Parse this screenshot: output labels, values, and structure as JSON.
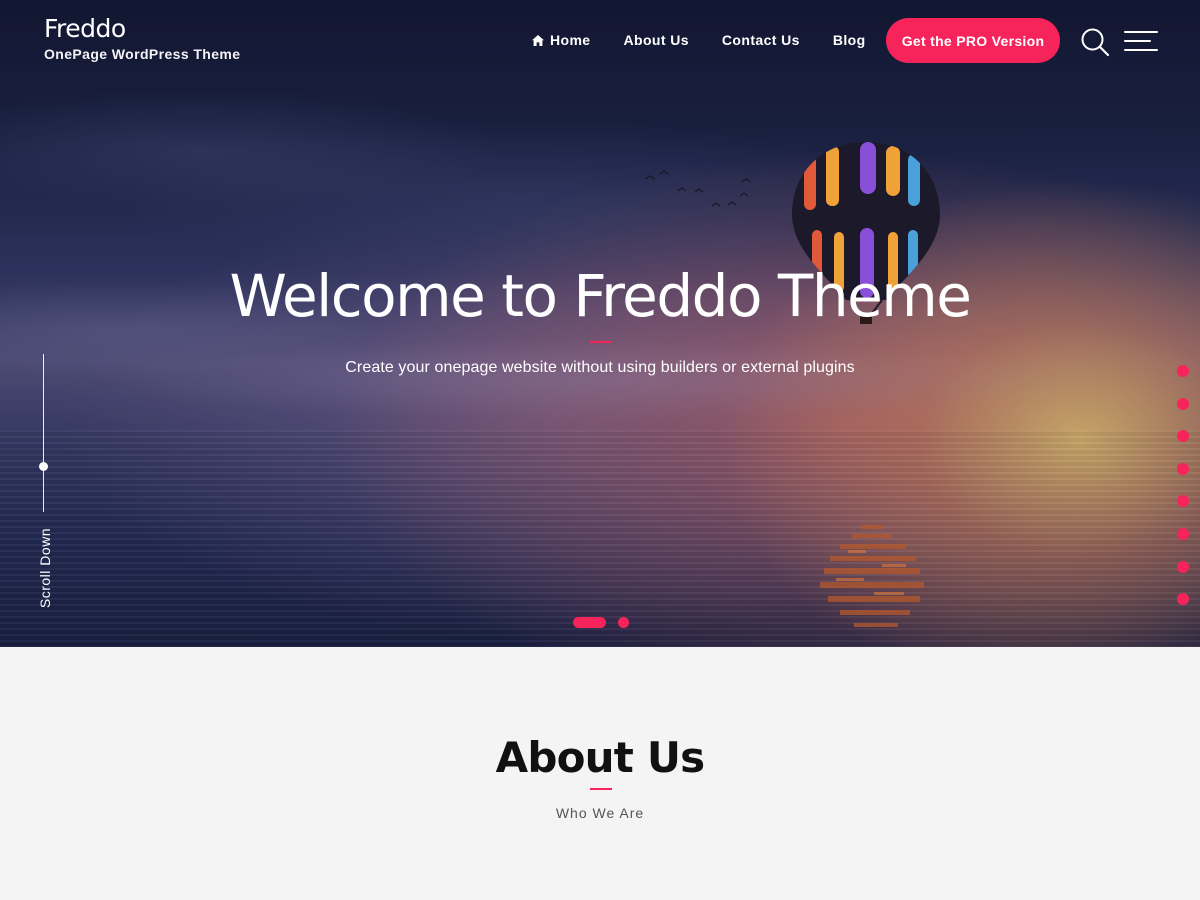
{
  "site": {
    "title": "Freddo",
    "tagline": "OnePage WordPress Theme"
  },
  "nav": {
    "items": [
      {
        "label": "Home",
        "icon": "home-icon"
      },
      {
        "label": "About Us"
      },
      {
        "label": "Contact Us"
      },
      {
        "label": "Blog"
      }
    ],
    "cta_label": "Get the PRO Version",
    "search_icon": "search-icon",
    "menu_icon": "hamburger-menu-icon"
  },
  "hero": {
    "title": "Welcome to Freddo Theme",
    "subtitle": "Create your onepage website without using builders or external plugins",
    "scroll_label": "Scroll Down",
    "section_dot_count": 8,
    "slides": 2,
    "active_slide": 1
  },
  "about": {
    "title": "About Us",
    "subtitle": "Who We Are"
  },
  "colors": {
    "accent": "#f7245b",
    "text_light": "#ffffff",
    "section_bg": "#f4f4f4",
    "heading_dark": "#111111"
  }
}
